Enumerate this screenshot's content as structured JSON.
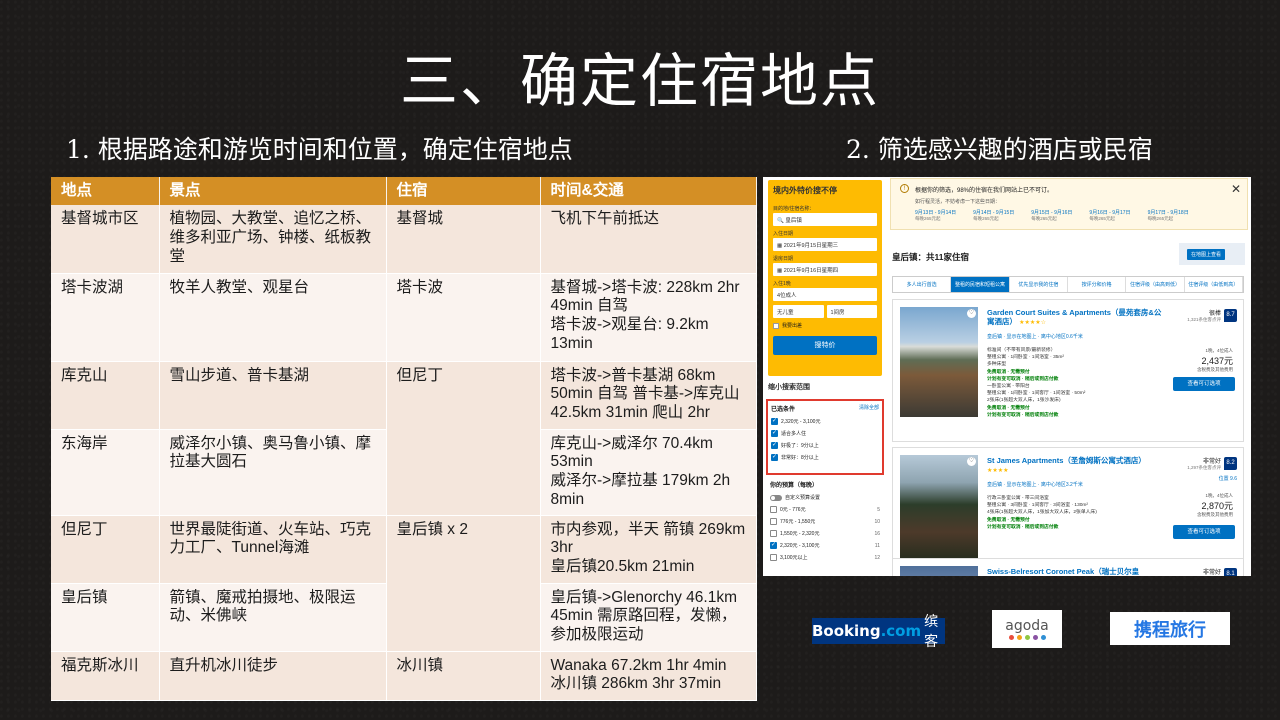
{
  "slide": {
    "title": "三、确定住宿地点",
    "subtitle_left": "1. 根据路途和游览时间和位置，确定住宿地点",
    "subtitle_right": "2. 筛选感兴趣的酒店或民宿"
  },
  "table": {
    "headers": [
      "地点",
      "景点",
      "住宿",
      "时间&交通"
    ],
    "rows": [
      {
        "place": "基督城市区",
        "sights": "植物园、大教堂、追忆之桥、维多利亚广场、钟楼、纸板教堂",
        "stay": "基督城",
        "transport": "飞机下午前抵达"
      },
      {
        "place": "塔卡波湖",
        "sights": "牧羊人教堂、观星台",
        "stay": "塔卡波",
        "transport": "基督城->塔卡波: 228km 2hr 49min 自驾\n塔卡波->观星台: 9.2km 13min"
      },
      {
        "place": "库克山",
        "sights": "雪山步道、普卡基湖",
        "stay": "但尼丁",
        "transport": "塔卡波->普卡基湖 68km 50min 自驾 普卡基->库克山 42.5km 31min 爬山 2hr"
      },
      {
        "place": "东海岸",
        "sights": "威泽尔小镇、奥马鲁小镇、摩拉基大圆石",
        "stay": "",
        "transport": "库克山->威泽尔 70.4km 53min\n威泽尔->摩拉基 179km 2h 8min"
      },
      {
        "place": "但尼丁",
        "sights": "世界最陡街道、火车站、巧克力工厂、Tunnel海滩",
        "stay": "皇后镇 x 2",
        "transport": "市内参观，半天 箭镇 269km 3hr\n皇后镇20.5km 21min"
      },
      {
        "place": "皇后镇",
        "sights": "箭镇、魔戒拍摄地、极限运动、米佛峡",
        "stay": "",
        "transport": "皇后镇->Glenorchy  46.1km 45min 需原路回程，发懒，参加极限运动"
      },
      {
        "place": "福克斯冰川",
        "sights": "直升机冰川徒步",
        "stay": "冰川镇",
        "transport": "Wanaka 67.2km 1hr 4min\n冰川镇 286km 3hr 37min"
      }
    ]
  },
  "booking": {
    "search": {
      "title": "境内外特价搜不停",
      "dest_label": "目的地/住宿名称：",
      "dest_value": "皇后镇",
      "checkin_label": "入住日期",
      "checkin_value": "2021年9月15日星期三",
      "checkout_label": "退房日期",
      "checkout_value": "2021年9月16日星期四",
      "nights_label": "入住1晚",
      "adults": "4位成人",
      "children": "无儿童",
      "rooms": "1间房",
      "work_trip": "我要出差",
      "search_button": "搜特价"
    },
    "filters": {
      "narrow_title": "缩小搜索范围",
      "selected_title": "已选条件",
      "clear_all": "清除全部",
      "selected": [
        "2,320元 - 3,100元",
        "适合多人住",
        "好极了：9分以上",
        "非常好：8分以上"
      ],
      "budget_title": "你的预算（每晚）",
      "budget_toggle": "自定义预算设置",
      "budget_options": [
        {
          "label": "0元 - 776元",
          "count": "5",
          "checked": false
        },
        {
          "label": "776元 - 1,550元",
          "count": "10",
          "checked": false
        },
        {
          "label": "1,550元 - 2,320元",
          "count": "16",
          "checked": false
        },
        {
          "label": "2,320元 - 3,100元",
          "count": "11",
          "checked": true
        },
        {
          "label": "3,100元以上",
          "count": "12",
          "checked": false
        }
      ]
    },
    "notice": {
      "text": "根据你的筛选，98%的住宿在我们网站上已不可订。",
      "sub": "如行程灵活，不妨考虑一下这些日期：",
      "dates": [
        {
          "range": "9月13日 - 9月14日",
          "price": "每晚265元起"
        },
        {
          "range": "9月14日 - 9月15日",
          "price": "每晚265元起"
        },
        {
          "range": "9月15日 - 9月16日",
          "price": "每晚265元起"
        },
        {
          "range": "9月16日 - 9月17日",
          "price": "每晚265元起"
        },
        {
          "range": "9月17日 - 9月18日",
          "price": "每晚265元起"
        }
      ]
    },
    "results_header": "皇后镇：共11家住宿",
    "map_button": "在地图上查看",
    "tabs": [
      "多人出行首选",
      "整租的民宿和短租公寓",
      "优先显示我的住宿",
      "按评分和价格",
      "住宿评级（由高到低）",
      "住宿评级（由低到高）"
    ],
    "hotels": [
      {
        "name": "Garden Court Suites & Apartments（曼苑套房&公寓酒店）",
        "stars": "★★★★☆",
        "location": "皇后镇 · 显示在地图上 · 离中心地区0.6千米",
        "rating_word": "很棒",
        "reviews": "1,321条住客点评",
        "score": "8.7",
        "room1": "标准间（不带有风景/最新装修）",
        "room1_info": "整租公寓 · 1间卧室 · 1间浴室 · 35m²",
        "room1_beds": "多种床型",
        "cancel": "免费取消 · 无需预付",
        "cancel_note": "计划有变可取消 · 稍后或到店付款",
        "room2": "一卧室公寓 - 带阳台",
        "room2_info": "整租公寓 · 1间卧室 · 1间客厅 · 1间浴室 · 50m²",
        "room2_beds": "2张床(1张超大双人床，1张沙发床)",
        "nights": "1晚，4位成人",
        "price": "2,437元",
        "price_note": "含税费及其他费用",
        "button": "查看可订选项"
      },
      {
        "name": "St James Apartments（圣詹姆斯公寓式酒店）",
        "stars": "★★★★",
        "location": "皇后镇 · 显示在地图上 · 离中心地区3.2千米",
        "rating_word": "非常好",
        "reviews": "1,297条住客点评",
        "score": "8.2",
        "location_score": "位置 9.6",
        "room1": "行政三卧室公寓 - 带三间浴室",
        "room1_info": "整租公寓 · 3间卧室 · 1间客厅 · 3间浴室 · 130m²",
        "room1_beds": "4张床(1张超大双人床，1张加大双人床，2张单人床)",
        "cancel": "免费取消 · 无需预付",
        "cancel_note": "计划有变可取消 · 稍后或到店付款",
        "nights": "1晚，4位成人",
        "price": "2,870元",
        "price_note": "含税费及其他费用",
        "button": "查看可订选项"
      },
      {
        "name": "Swiss-Belresort Coronet Peak（瑞士贝尔皇",
        "rating_word": "非常好",
        "score": "8.1"
      }
    ]
  },
  "logos": {
    "booking": "Booking",
    "booking_dot": ".com",
    "booking_cn": "缤客",
    "agoda": "agoda",
    "ctrip": "携程旅行"
  }
}
